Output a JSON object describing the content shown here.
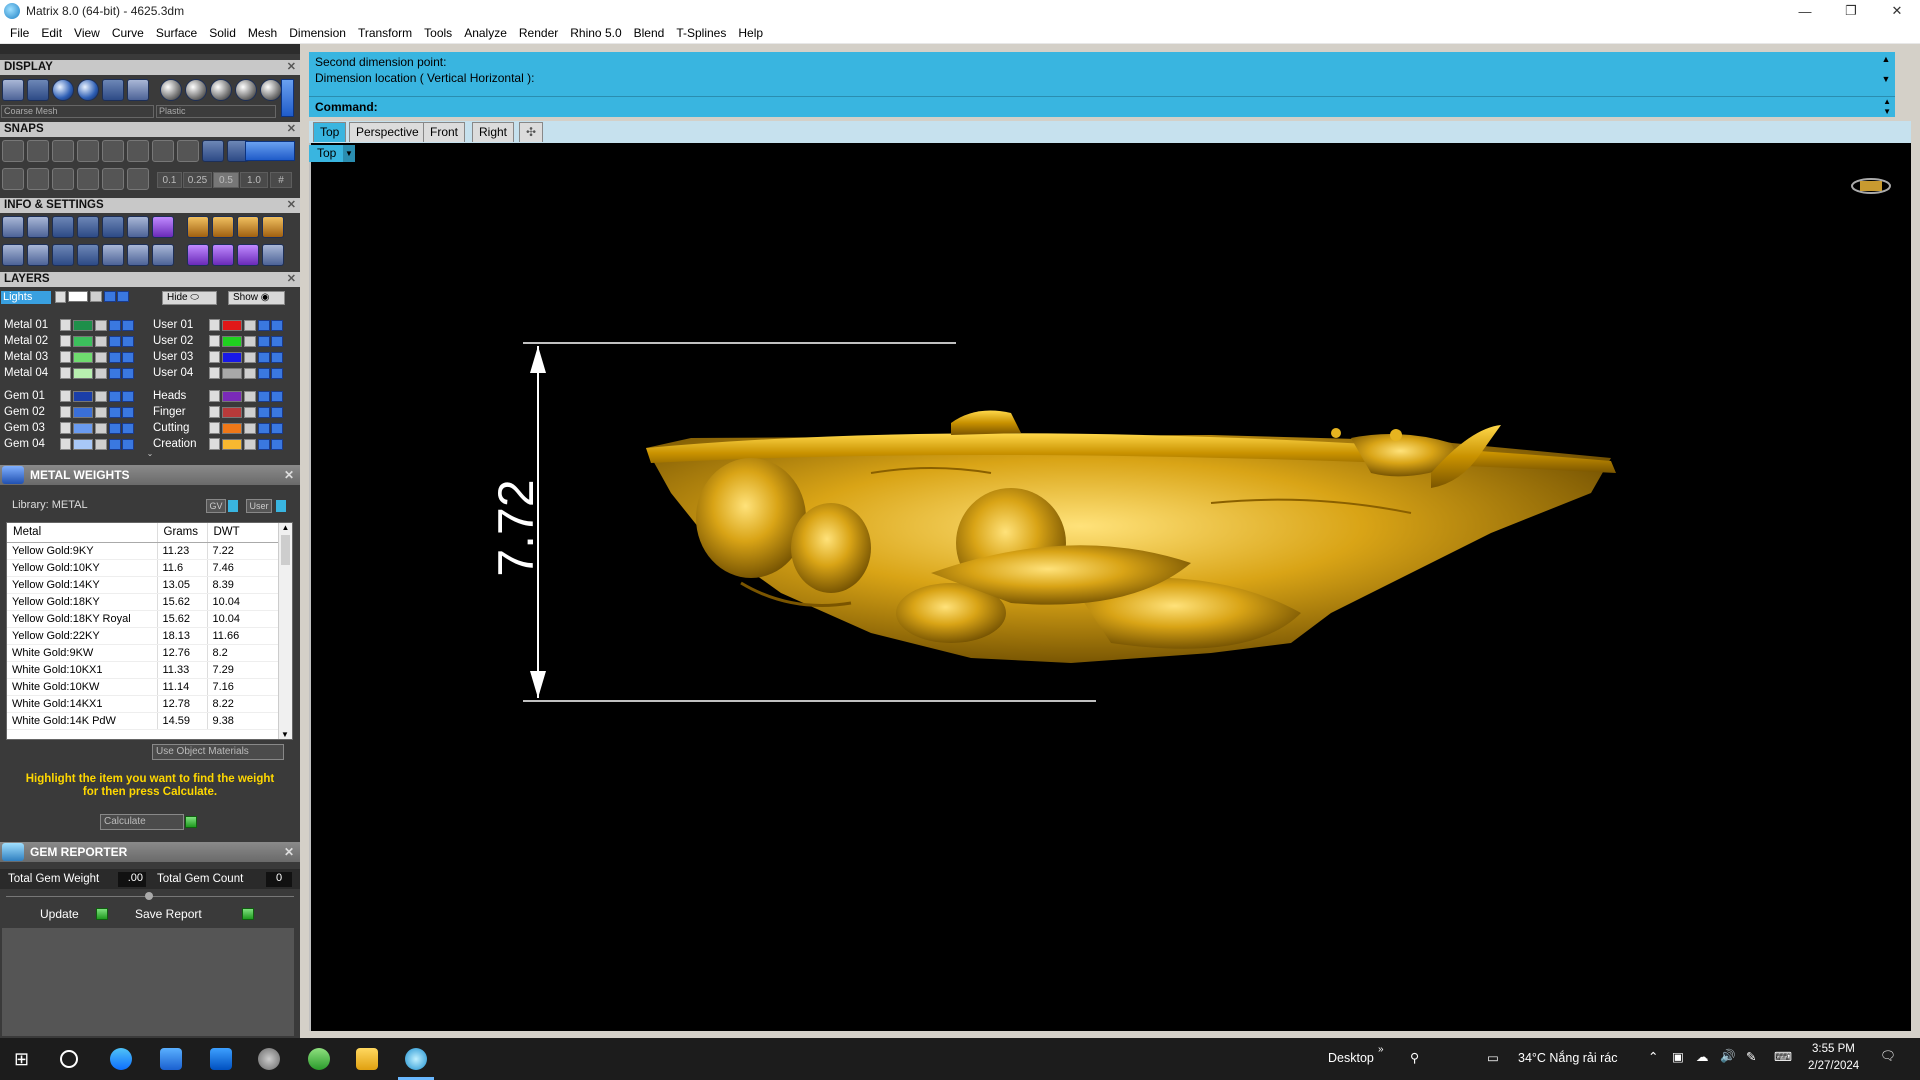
{
  "window": {
    "title": "Matrix 8.0 (64-bit) - 4625.3dm",
    "minimize": "—",
    "restore": "❐",
    "close": "✕"
  },
  "menu": [
    "File",
    "Edit",
    "View",
    "Curve",
    "Surface",
    "Solid",
    "Mesh",
    "Dimension",
    "Transform",
    "Tools",
    "Analyze",
    "Render",
    "Rhino 5.0",
    "Blend",
    "T-Splines",
    "Help"
  ],
  "panels": {
    "display": {
      "title": "DISPLAY",
      "mesh_select": "Coarse Mesh",
      "material_select": "Plastic"
    },
    "snaps": {
      "title": "SNAPS",
      "steps": [
        "0.1",
        "0.25",
        "0.5",
        "1.0"
      ]
    },
    "info": {
      "title": "INFO & SETTINGS"
    },
    "layers": {
      "title": "LAYERS",
      "lights_label": "Lights",
      "hide_label": "Hide",
      "show_label": "Show",
      "left": [
        {
          "name": "Metal 01",
          "color": "#1e8f4a"
        },
        {
          "name": "Metal 02",
          "color": "#3cbf5c"
        },
        {
          "name": "Metal 03",
          "color": "#6fdc6f"
        },
        {
          "name": "Metal 04",
          "color": "#b8f0b0"
        },
        {
          "name": "Gem 01",
          "color": "#1a3ea8"
        },
        {
          "name": "Gem 02",
          "color": "#3a6fd8"
        },
        {
          "name": "Gem 03",
          "color": "#6a9bf0"
        },
        {
          "name": "Gem 04",
          "color": "#a8c8f8"
        }
      ],
      "right": [
        {
          "name": "User 01",
          "color": "#e01818"
        },
        {
          "name": "User 02",
          "color": "#20d020"
        },
        {
          "name": "User 03",
          "color": "#1818e8"
        },
        {
          "name": "User 04",
          "color": "#a8a8a8"
        },
        {
          "name": "Heads",
          "color": "#7a2ab8"
        },
        {
          "name": "Finger",
          "color": "#b83a3a"
        },
        {
          "name": "Cutting",
          "color": "#f07818"
        },
        {
          "name": "Creation",
          "color": "#f8b830"
        }
      ]
    },
    "metal_weights": {
      "title": "METAL WEIGHTS",
      "library_label": "Library: METAL",
      "gv_label": "GV",
      "user_label": "User",
      "columns": [
        "Metal",
        "Grams",
        "DWT"
      ],
      "rows": [
        [
          "Yellow Gold:9KY",
          "11.23",
          "7.22"
        ],
        [
          "Yellow Gold:10KY",
          "11.6",
          "7.46"
        ],
        [
          "Yellow Gold:14KY",
          "13.05",
          "8.39"
        ],
        [
          "Yellow Gold:18KY",
          "15.62",
          "10.04"
        ],
        [
          "Yellow Gold:18KY Royal",
          "15.62",
          "10.04"
        ],
        [
          "Yellow Gold:22KY",
          "18.13",
          "11.66"
        ],
        [
          "White Gold:9KW",
          "12.76",
          "8.2"
        ],
        [
          "White Gold:10KX1",
          "11.33",
          "7.29"
        ],
        [
          "White Gold:10KW",
          "11.14",
          "7.16"
        ],
        [
          "White Gold:14KX1",
          "12.78",
          "8.22"
        ],
        [
          "White Gold:14K PdW",
          "14.59",
          "9.38"
        ]
      ],
      "use_object_materials": "Use Object Materials",
      "hint_line1": "Highlight the item you want to find the weight",
      "hint_line2": "for then press Calculate.",
      "calculate": "Calculate"
    },
    "gem_reporter": {
      "title": "GEM REPORTER",
      "total_weight_label": "Total Gem Weight",
      "total_weight_value": ".00",
      "total_count_label": "Total Gem Count",
      "total_count_value": "0",
      "update": "Update",
      "save_report": "Save Report"
    }
  },
  "command": {
    "history": [
      "Second dimension point:",
      "Dimension location ( Vertical  Horizontal ):"
    ],
    "label": "Command:"
  },
  "viewport_tabs": [
    "Top",
    "Perspective",
    "Front",
    "Right"
  ],
  "active_view": "Top",
  "dimension_value": "7.72",
  "taskbar": {
    "desktop": "Desktop",
    "weather": "34°C  Nắng rải rác",
    "time": "3:55 PM",
    "date": "2/27/2024"
  },
  "colors": {
    "command_bg": "#39b5e0",
    "gold": "#d4a017"
  }
}
